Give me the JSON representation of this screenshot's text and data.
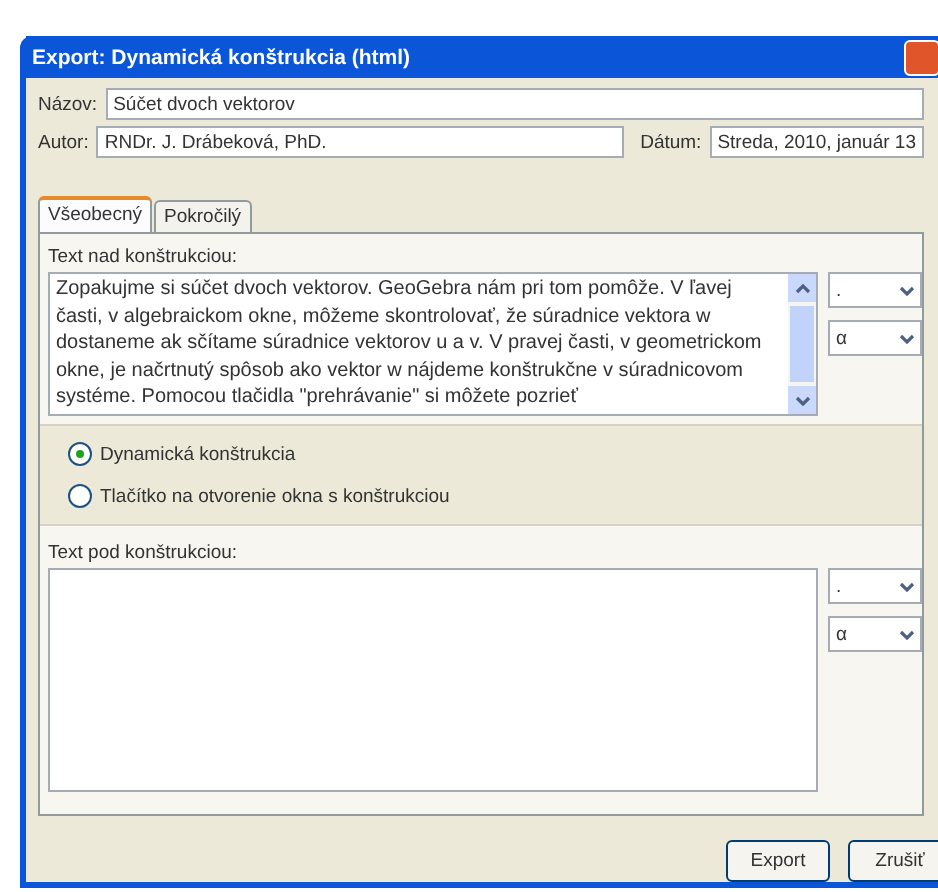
{
  "window": {
    "title": "Export: Dynamická konštrukcia (html)"
  },
  "fields": [
    {
      "label": "Názov:",
      "value": "Súčet dvoch vektorov"
    },
    {
      "label": "Autor:",
      "value": "RNDr. J. Drábeková, PhD."
    },
    {
      "label": "Dátum:",
      "value": "Streda, 2010, január 13"
    }
  ],
  "tabs": [
    {
      "label": "Všeobecný",
      "selected": true
    },
    {
      "label": "Pokročilý",
      "selected": false
    }
  ],
  "text_above": {
    "label": "Text nad konštrukciou:",
    "value": "Zopakujme si súčet dvoch vektorov. GeoGebra nám pri tom pomôže. V ľavej časti, v algebraickom okne, môžeme skontrolovať, že súradnice vektora w dostaneme ak sčítame súradnice vektorov u a v. V pravej časti, v geometrickom okne, je načrtnutý spôsob ako vektor w nájdeme konštrukčne v súradnicovom systéme. Pomocou tlačidla \"prehrávanie\" si môžete pozrieť",
    "combos": [
      ".",
      "α"
    ]
  },
  "options": [
    {
      "label": "Dynamická konštrukcia",
      "selected": true
    },
    {
      "label": "Tlačítko na otvorenie okna s konštrukciou",
      "selected": false
    }
  ],
  "text_below": {
    "label": "Text pod konštrukciou:",
    "combos": [
      ".",
      "α"
    ]
  },
  "buttons": [
    "Export",
    "Zrušiť"
  ]
}
